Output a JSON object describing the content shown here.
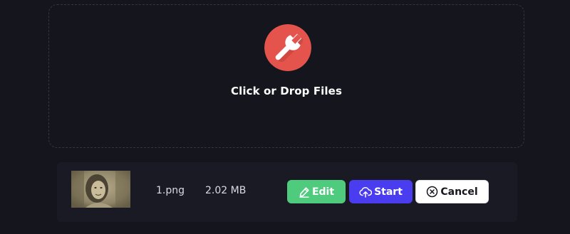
{
  "dropzone": {
    "label": "Click or Drop Files",
    "icon": "wrench-icon",
    "icon_color": "#e4544c"
  },
  "files": [
    {
      "name": "1.png",
      "size": "2.02 MB",
      "thumbnail": "sepia-photo-thumbnail"
    }
  ],
  "actions": {
    "edit_label": "Edit",
    "edit_icon": "pencil-icon",
    "edit_color": "#4fcb7d",
    "start_label": "Start",
    "start_icon": "cloud-upload-icon",
    "start_color": "#4a3df0",
    "cancel_label": "Cancel",
    "cancel_icon": "close-circle-icon",
    "cancel_color": "#ffffff"
  },
  "colors": {
    "background": "#14151d",
    "row_background": "#191a23"
  }
}
